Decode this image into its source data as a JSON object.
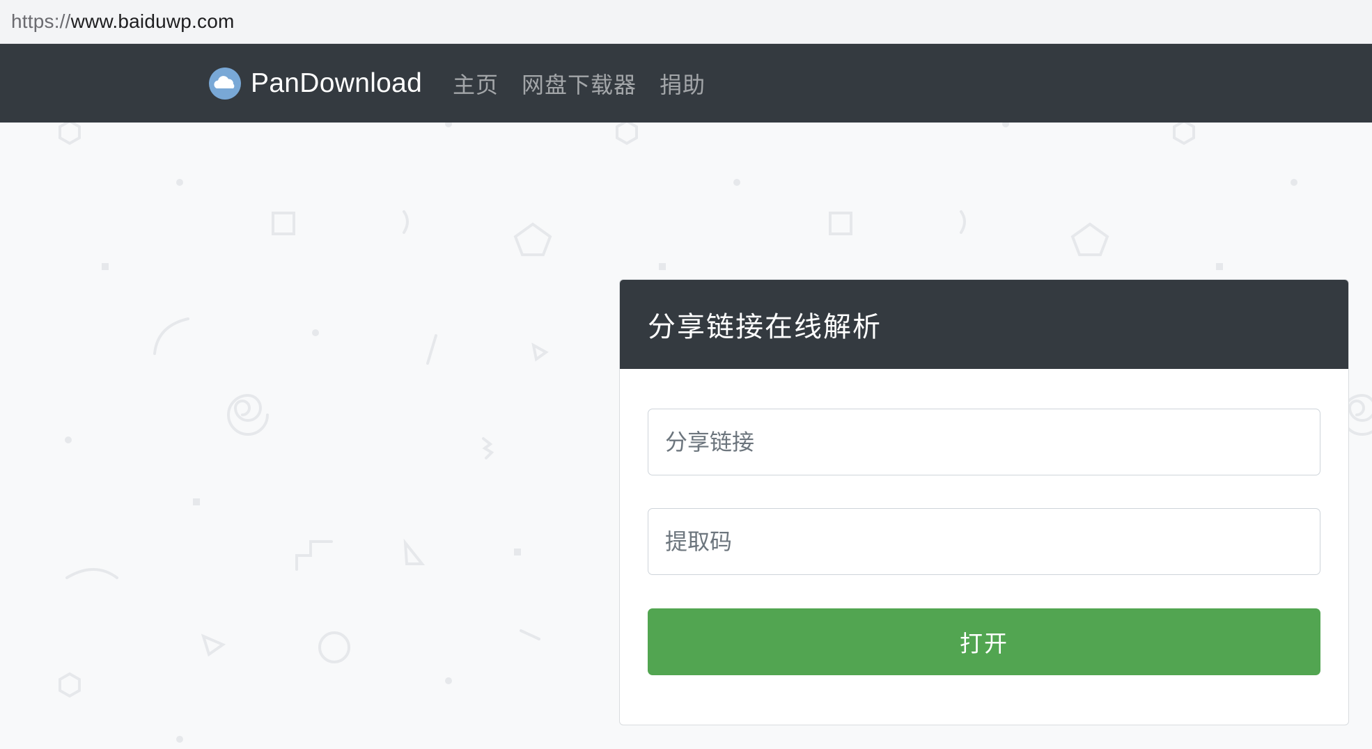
{
  "browser": {
    "url_scheme": "https://",
    "url_host": "www.baiduwp.com"
  },
  "navbar": {
    "brand": "PanDownload",
    "brand_icon": "cloud-icon",
    "links": [
      "主页",
      "网盘下载器",
      "捐助"
    ],
    "background_color": "#343a40"
  },
  "card": {
    "title": "分享链接在线解析",
    "share_link": {
      "placeholder": "分享链接",
      "value": ""
    },
    "extract_code": {
      "placeholder": "提取码",
      "value": ""
    },
    "open_button": "打开",
    "button_color": "#52a551"
  }
}
